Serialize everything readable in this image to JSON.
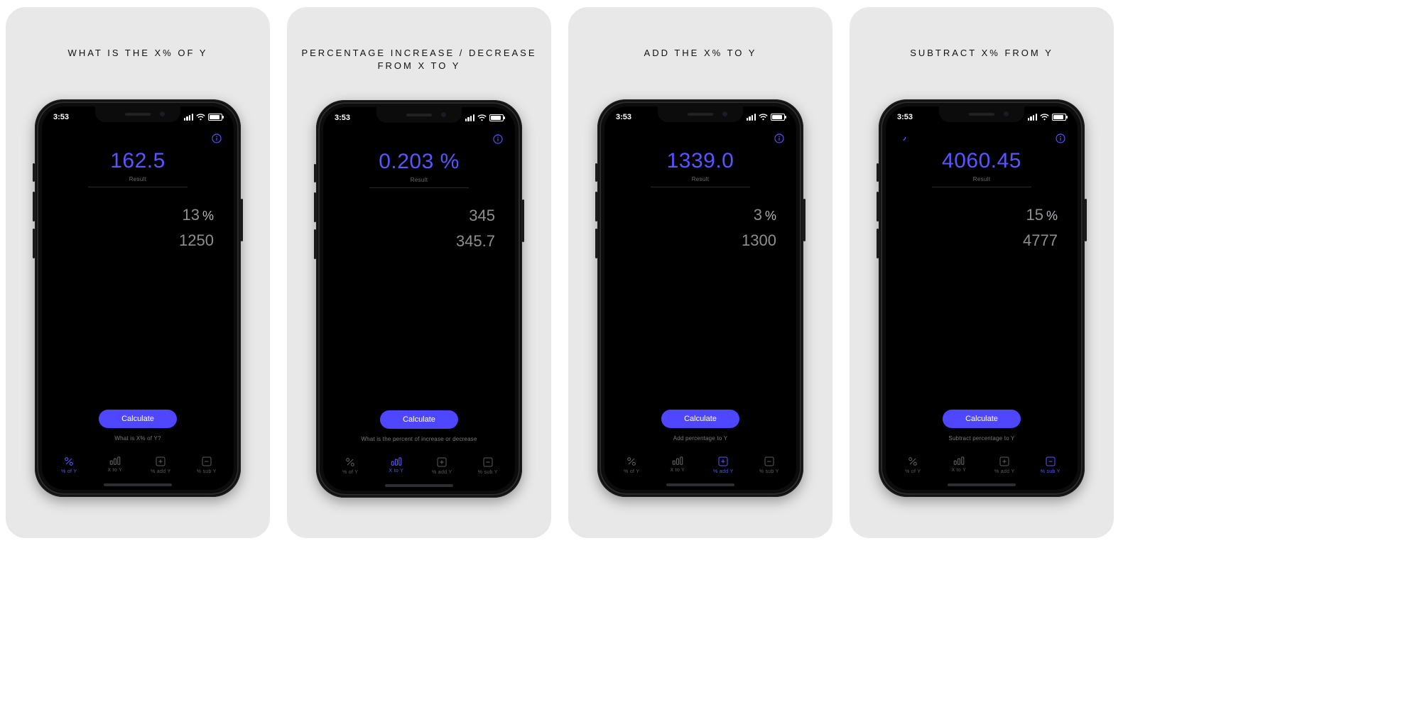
{
  "common": {
    "time": "3:53",
    "result_label": "Result",
    "calculate_label": "Calculate",
    "tabs": [
      {
        "key": "pct_of_y",
        "label": "% of Y"
      },
      {
        "key": "x_to_y",
        "label": "X to Y"
      },
      {
        "key": "pct_add_y",
        "label": "% add Y"
      },
      {
        "key": "pct_sub_y",
        "label": "% sub Y"
      }
    ]
  },
  "shots": [
    {
      "title": "WHAT IS THE X% OF Y",
      "result": "162.5",
      "input1": "13",
      "input1_unit": "%",
      "input2": "1250",
      "hint": "What is X% of Y?",
      "active_tab": 0,
      "has_spinner": false
    },
    {
      "title": "PERCENTAGE INCREASE / DECREASE\nFROM X TO Y",
      "result": "0.203 %",
      "input1": "345",
      "input1_unit": "",
      "input2": "345.7",
      "hint": "What is the percent of increase or decrease",
      "active_tab": 1,
      "has_spinner": false
    },
    {
      "title": "ADD THE X% TO Y",
      "result": "1339.0",
      "input1": "3",
      "input1_unit": "%",
      "input2": "1300",
      "hint": "Add percentage to Y",
      "active_tab": 2,
      "has_spinner": false
    },
    {
      "title": "SUBTRACT X% FROM Y",
      "result": "4060.45",
      "input1": "15",
      "input1_unit": "%",
      "input2": "4777",
      "hint": "Subtract percentage to Y",
      "active_tab": 3,
      "has_spinner": true
    }
  ]
}
